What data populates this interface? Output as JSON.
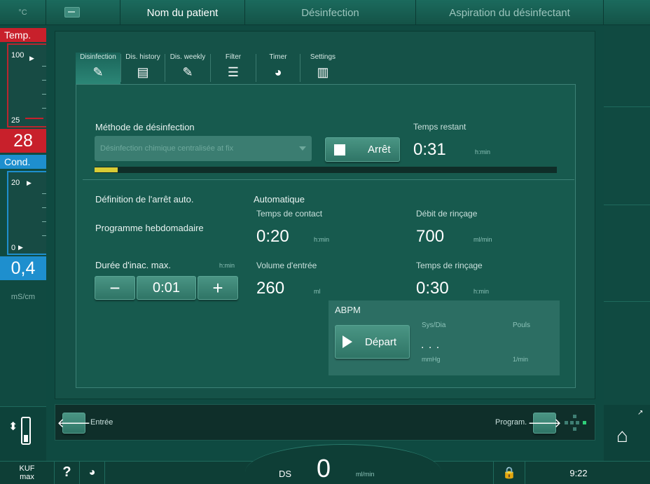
{
  "topbar": {
    "unit": "°C",
    "tabs": [
      "Nom du patient",
      "Désinfection",
      "Aspiration du désinfectant"
    ]
  },
  "left": {
    "temp": {
      "header": "Temp.",
      "top": "100",
      "bottom": "25",
      "value": "28"
    },
    "cond": {
      "header": "Cond.",
      "top": "20",
      "bottom": "0",
      "value": "0,4",
      "unit": "mS/cm"
    },
    "kuf": "KUF",
    "kuf_sub": "max"
  },
  "tabs": [
    {
      "label": "Disinfection",
      "icon": "disinfection-icon",
      "glyph": "✎"
    },
    {
      "label": "Dis. history",
      "icon": "history-icon",
      "glyph": "▤"
    },
    {
      "label": "Dis. weekly",
      "icon": "weekly-icon",
      "glyph": "✎"
    },
    {
      "label": "Filter",
      "icon": "filter-icon",
      "glyph": "☰"
    },
    {
      "label": "Timer",
      "icon": "timer-icon",
      "glyph": "◕"
    },
    {
      "label": "Settings",
      "icon": "settings-icon",
      "glyph": "▥"
    }
  ],
  "method": {
    "label": "Méthode de désinfection",
    "selected": "Désinfection chimique centralisée at fix"
  },
  "remaining": {
    "label": "Temps restant",
    "value": "0:31",
    "unit": "h:min"
  },
  "stop_button": "Arrêt",
  "progress": {
    "fraction": 0.05
  },
  "auto_stop": {
    "label": "Définition de l'arrêt auto.",
    "mode": "Automatique",
    "program": "Programme hebdomadaire"
  },
  "contact_time": {
    "label": "Temps de contact",
    "value": "0:20",
    "unit": "h:min"
  },
  "rinse_flow": {
    "label": "Débit de rinçage",
    "value": "700",
    "unit": "ml/min"
  },
  "inactivity": {
    "label": "Durée d'inac. max.",
    "unit": "h:min",
    "value": "0:01",
    "minus": "−",
    "plus": "+"
  },
  "inlet_volume": {
    "label": "Volume d'entrée",
    "value": "260",
    "unit": "ml"
  },
  "rinse_time": {
    "label": "Temps de rinçage",
    "value": "0:30",
    "unit": "h:min"
  },
  "abpm": {
    "title": "ABPM",
    "start": "Départ",
    "sys_dia": "Sys/Dia",
    "pulse": "Pouls",
    "reading": ". . .",
    "unit_mmhg": "mmHg",
    "unit_min": "1/min"
  },
  "nav": {
    "back": "Entrée",
    "next": "Program.",
    "back_glyph": "🡐",
    "next_glyph": "🡒"
  },
  "bottom": {
    "help": "?",
    "ds_label": "DS",
    "ds_value": "0",
    "ds_unit": "ml/min",
    "time": "9:22"
  },
  "colors": {
    "temp": "#c8202b",
    "cond": "#1e8fce",
    "progress": "#d8cb35",
    "background": "#0f4a41"
  }
}
